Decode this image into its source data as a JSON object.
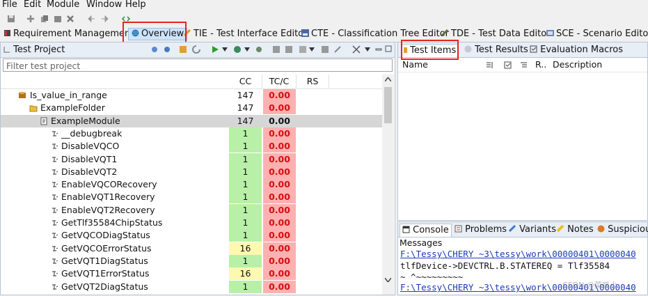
{
  "menu": [
    "File",
    "Edit",
    "Module",
    "Window",
    "Help"
  ],
  "perspectives": [
    {
      "label": "Requirement Management",
      "icon": "book-icon"
    },
    {
      "label": "Overview",
      "icon": "globe-icon"
    },
    {
      "label": "TIE - Test Interface Editor",
      "icon": "interface-icon"
    },
    {
      "label": "CTE - Classification Tree Editor",
      "icon": "tree-icon"
    },
    {
      "label": "TDE - Test Data Editor",
      "icon": "data-icon"
    },
    {
      "label": "SCE - Scenario Editor",
      "icon": "scenario-icon"
    }
  ],
  "test_project": {
    "title": "Test Project",
    "filter_placeholder": "Filter test project",
    "columns": [
      "CC",
      "TC/C",
      "RS"
    ],
    "rows": [
      {
        "label": "Is_value_in_range",
        "cc": "147",
        "tc": "0.00",
        "type": "project"
      },
      {
        "label": "ExampleFolder",
        "cc": "147",
        "tc": "0.00",
        "type": "folder"
      },
      {
        "label": "ExampleModule",
        "cc": "147",
        "tc": "0.00",
        "type": "module"
      },
      {
        "label": "__debugbreak",
        "cc": "1",
        "tc": "0.00",
        "type": "function"
      },
      {
        "label": "DisableVQCO",
        "cc": "1",
        "tc": "0.00",
        "type": "function"
      },
      {
        "label": "DisableVQT1",
        "cc": "1",
        "tc": "0.00",
        "type": "function"
      },
      {
        "label": "DisableVQT2",
        "cc": "1",
        "tc": "0.00",
        "type": "function"
      },
      {
        "label": "EnableVQCORecovery",
        "cc": "1",
        "tc": "0.00",
        "type": "function"
      },
      {
        "label": "EnableVQT1Recovery",
        "cc": "1",
        "tc": "0.00",
        "type": "function"
      },
      {
        "label": "EnableVQT2Recovery",
        "cc": "1",
        "tc": "0.00",
        "type": "function"
      },
      {
        "label": "GetTlf35584ChipStatus",
        "cc": "1",
        "tc": "0.00",
        "type": "function"
      },
      {
        "label": "GetVQCODiagStatus",
        "cc": "1",
        "tc": "0.00",
        "type": "function"
      },
      {
        "label": "GetVQCOErrorStatus",
        "cc": "16",
        "tc": "0.00",
        "type": "function"
      },
      {
        "label": "GetVQT1DiagStatus",
        "cc": "1",
        "tc": "0.00",
        "type": "function"
      },
      {
        "label": "GetVQT1ErrorStatus",
        "cc": "16",
        "tc": "0.00",
        "type": "function"
      },
      {
        "label": "GetVQT2DiagStatus",
        "cc": "1",
        "tc": "0.00",
        "type": "function"
      }
    ]
  },
  "right_tabs": [
    {
      "label": "Test Items"
    },
    {
      "label": "Test Results"
    },
    {
      "label": "Evaluation Macros"
    }
  ],
  "test_items_columns": {
    "name": "Name",
    "r": "R..",
    "description": "Description"
  },
  "console_tabs": [
    {
      "label": "Console"
    },
    {
      "label": "Problems"
    },
    {
      "label": "Variants"
    },
    {
      "label": "Notes"
    },
    {
      "label": "Suspicious"
    }
  ],
  "console": {
    "messages_label": "Messages",
    "lines": [
      "F:\\Tessy\\CHERY ~3\\tessy\\work\\00000401\\0000040",
      "    tlfDevice->DEVCTRL.B.STATEREQ = Tlf35584",
      "                                  ~ ^~~~~~~~~~",
      "F:\\Tessy\\CHERY ~3\\tessy\\work\\00000401\\0000040"
    ],
    "watermark": "CSDN @菜鸡小"
  },
  "colors": {
    "cc_green": "#b8f0a8",
    "cc_yellow": "#fff8b0",
    "tc_red_bg": "#ffb0b0",
    "highlight_box": "#e8231b"
  }
}
